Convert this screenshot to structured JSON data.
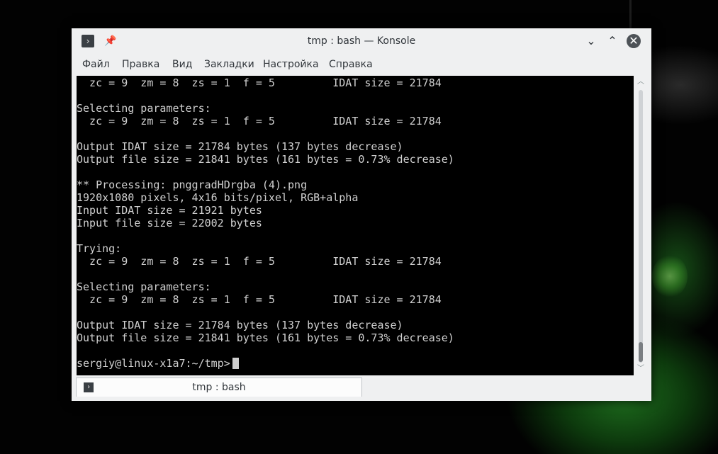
{
  "window": {
    "title": "tmp : bash — Konsole",
    "app_icon": "terminal-icon",
    "app_icon_glyph": "›",
    "pin_icon": "pin-icon",
    "pin_glyph": "📌",
    "minimize_glyph": "⌄",
    "maximize_glyph": "⌃",
    "close_glyph": "✕"
  },
  "menu": {
    "items": [
      {
        "label": "Файл"
      },
      {
        "label": "Правка"
      },
      {
        "label": "Вид"
      },
      {
        "label": "Закладки"
      },
      {
        "label": "Настройка"
      },
      {
        "label": "Справка"
      }
    ]
  },
  "terminal": {
    "lines": [
      "  zc = 9  zm = 8  zs = 1  f = 5         IDAT size = 21784",
      "",
      "Selecting parameters:",
      "  zc = 9  zm = 8  zs = 1  f = 5         IDAT size = 21784",
      "",
      "Output IDAT size = 21784 bytes (137 bytes decrease)",
      "Output file size = 21841 bytes (161 bytes = 0.73% decrease)",
      "",
      "** Processing: pnggradHDrgba (4).png",
      "1920x1080 pixels, 4x16 bits/pixel, RGB+alpha",
      "Input IDAT size = 21921 bytes",
      "Input file size = 22002 bytes",
      "",
      "Trying:",
      "  zc = 9  zm = 8  zs = 1  f = 5         IDAT size = 21784",
      "",
      "Selecting parameters:",
      "  zc = 9  zm = 8  zs = 1  f = 5         IDAT size = 21784",
      "",
      "Output IDAT size = 21784 bytes (137 bytes decrease)",
      "Output file size = 21841 bytes (161 bytes = 0.73% decrease)",
      ""
    ],
    "prompt": "sergiy@linux-x1a7:~/tmp> "
  },
  "scrollbar": {
    "up_glyph": "︿",
    "down_glyph": "﹀"
  },
  "tabs": [
    {
      "label": "tmp : bash",
      "icon_glyph": "›"
    }
  ]
}
